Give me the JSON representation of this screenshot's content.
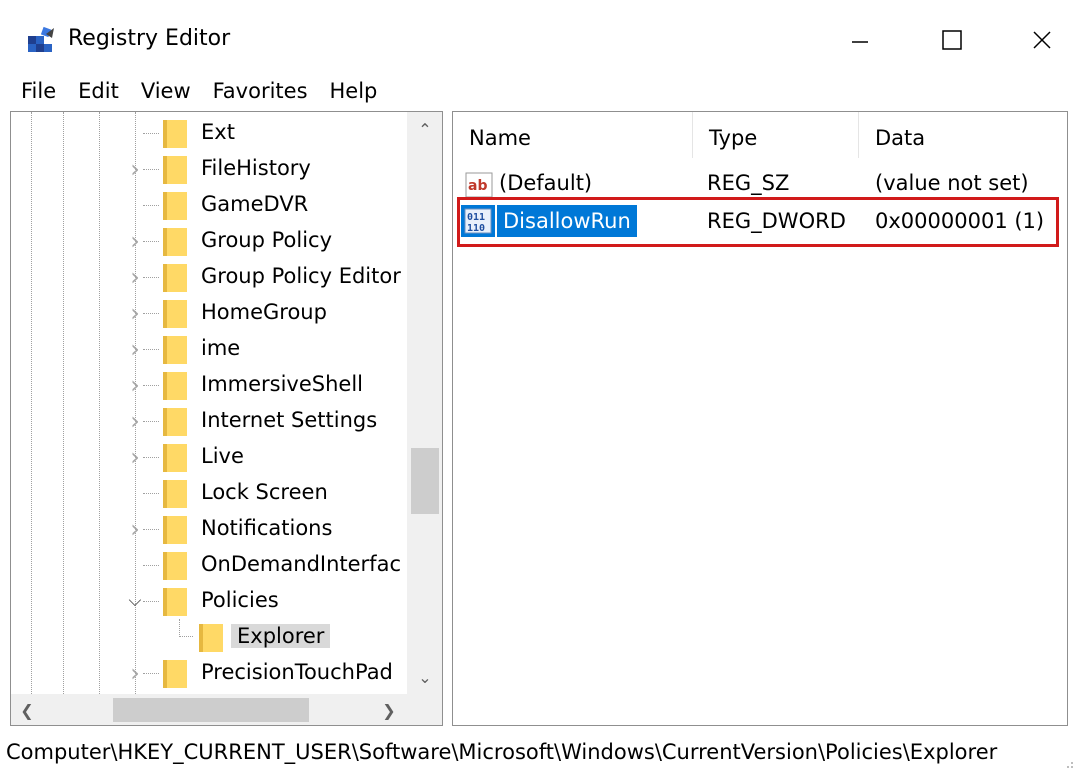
{
  "window": {
    "title": "Registry Editor",
    "icons": {
      "app": "registry-editor-icon",
      "minimize": "minimize-icon",
      "maximize": "maximize-icon",
      "close": "close-icon"
    }
  },
  "menu": [
    "File",
    "Edit",
    "View",
    "Favorites",
    "Help"
  ],
  "tree": {
    "items": [
      {
        "label": "Ext",
        "expander": "none"
      },
      {
        "label": "FileHistory",
        "expander": "collapsed"
      },
      {
        "label": "GameDVR",
        "expander": "none"
      },
      {
        "label": "Group Policy",
        "expander": "collapsed"
      },
      {
        "label": "Group Policy Editor",
        "expander": "collapsed"
      },
      {
        "label": "HomeGroup",
        "expander": "collapsed"
      },
      {
        "label": "ime",
        "expander": "collapsed"
      },
      {
        "label": "ImmersiveShell",
        "expander": "collapsed"
      },
      {
        "label": "Internet Settings",
        "expander": "collapsed"
      },
      {
        "label": "Live",
        "expander": "collapsed"
      },
      {
        "label": "Lock Screen",
        "expander": "none"
      },
      {
        "label": "Notifications",
        "expander": "collapsed"
      },
      {
        "label": "OnDemandInterfac",
        "expander": "none"
      },
      {
        "label": "Policies",
        "expander": "expanded"
      },
      {
        "label": "Explorer",
        "expander": "none",
        "child": true,
        "selected": true
      },
      {
        "label": "PrecisionTouchPad",
        "expander": "collapsed"
      }
    ]
  },
  "values": {
    "columns": {
      "name": "Name",
      "type": "Type",
      "data": "Data"
    },
    "rows": [
      {
        "name": "(Default)",
        "type": "REG_SZ",
        "data": "(value not set)",
        "icon": "string-value-icon"
      },
      {
        "name": "DisallowRun",
        "type": "REG_DWORD",
        "data": "0x00000001 (1)",
        "icon": "binary-value-icon",
        "selected": true
      }
    ],
    "highlight_color": "#d11a1a",
    "selection_color": "#0078d7"
  },
  "status": {
    "path": "Computer\\HKEY_CURRENT_USER\\Software\\Microsoft\\Windows\\CurrentVersion\\Policies\\Explorer"
  }
}
